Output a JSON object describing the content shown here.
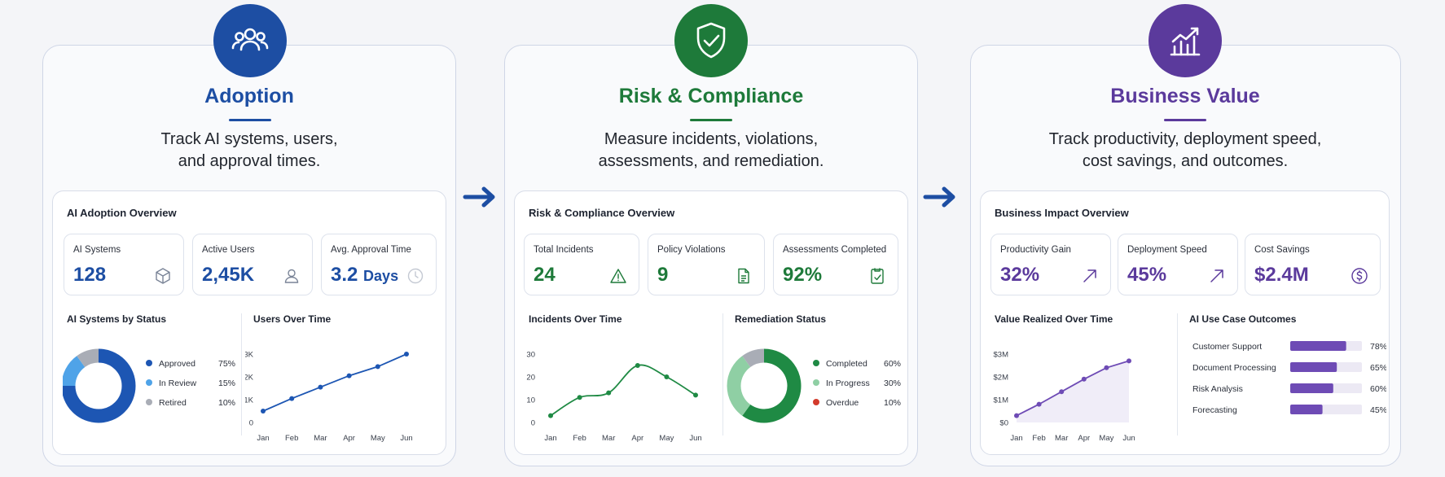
{
  "colors": {
    "adoption": "#1d4ea3",
    "risk": "#1e7a3a",
    "value": "#5b3a9c",
    "arrow": "#1d4ea3"
  },
  "adoption": {
    "title": "Adoption",
    "icon": "users-icon",
    "desc_line1": "Track AI systems, users,",
    "desc_line2": "and approval times.",
    "card_title": "AI Adoption Overview",
    "kpis": [
      {
        "label": "AI Systems",
        "value": "128",
        "icon": "cube-icon"
      },
      {
        "label": "Active Users",
        "value": "2,45K",
        "icon": "user-icon"
      },
      {
        "label": "Avg. Approval Time",
        "value": "3.2",
        "unit": "Days",
        "icon": "clock-icon"
      }
    ],
    "donut_title": "AI Systems by Status",
    "donut": [
      {
        "label": "Approved",
        "pct": "75%",
        "value": 75,
        "color": "#1d56b3"
      },
      {
        "label": "In Review",
        "pct": "15%",
        "value": 15,
        "color": "#4fa3e8"
      },
      {
        "label": "Retired",
        "pct": "10%",
        "value": 10,
        "color": "#a9adb6"
      }
    ],
    "line_title": "Users Over Time"
  },
  "risk": {
    "title": "Risk & Compliance",
    "icon": "shield-check-icon",
    "desc_line1": "Measure incidents, violations,",
    "desc_line2": "assessments, and remediation.",
    "card_title": "Risk & Compliance Overview",
    "kpis": [
      {
        "label": "Total Incidents",
        "value": "24",
        "icon": "warning-icon"
      },
      {
        "label": "Policy Violations",
        "value": "9",
        "icon": "document-icon"
      },
      {
        "label": "Assessments Completed",
        "value": "92%",
        "icon": "checklist-icon"
      }
    ],
    "line_title": "Incidents Over Time",
    "donut_title": "Remediation Status",
    "donut": [
      {
        "label": "Completed",
        "pct": "60%",
        "value": 60,
        "color": "#1f8a44"
      },
      {
        "label": "In Progress",
        "pct": "30%",
        "value": 30,
        "color": "#8fcfa4"
      },
      {
        "label": "Overdue",
        "pct": "10%",
        "value": 10,
        "color": "#a9adb6",
        "dot_color": "#d33b2c"
      }
    ]
  },
  "value": {
    "title": "Business Value",
    "icon": "growth-chart-icon",
    "desc_line1": "Track productivity, deployment speed,",
    "desc_line2": "cost savings, and outcomes.",
    "card_title": "Business Impact Overview",
    "kpis": [
      {
        "label": "Productivity Gain",
        "value": "32%",
        "icon": "trend-up-icon"
      },
      {
        "label": "Deployment Speed",
        "value": "45%",
        "icon": "trend-up-icon"
      },
      {
        "label": "Cost Savings",
        "value": "$2.4M",
        "icon": "dollar-icon"
      }
    ],
    "line_title": "Value Realized Over Time",
    "bars_title": "AI Use Case Outcomes",
    "bars": [
      {
        "label": "Customer Support",
        "pct": "78%",
        "value": 78
      },
      {
        "label": "Document Processing",
        "pct": "65%",
        "value": 65
      },
      {
        "label": "Risk Analysis",
        "pct": "60%",
        "value": 60
      },
      {
        "label": "Forecasting",
        "pct": "45%",
        "value": 45
      }
    ]
  },
  "chart_data": [
    {
      "type": "pie",
      "title": "AI Systems by Status",
      "categories": [
        "Approved",
        "In Review",
        "Retired"
      ],
      "values": [
        75,
        15,
        10
      ]
    },
    {
      "type": "line",
      "title": "Users Over Time",
      "x": [
        "Jan",
        "Feb",
        "Mar",
        "Apr",
        "May",
        "Jun"
      ],
      "y_ticks": [
        "0",
        "1K",
        "2K",
        "3K"
      ],
      "ylim": [
        0,
        3000
      ],
      "series": [
        {
          "values": [
            500,
            1050,
            1550,
            2050,
            2450,
            3000
          ]
        }
      ]
    },
    {
      "type": "line",
      "title": "Incidents Over Time",
      "x": [
        "Jan",
        "Feb",
        "Mar",
        "Apr",
        "May",
        "Jun"
      ],
      "y_ticks": [
        "0",
        "10",
        "20",
        "30"
      ],
      "ylim": [
        0,
        30
      ],
      "series": [
        {
          "values": [
            3,
            11,
            13,
            25,
            20,
            12
          ]
        }
      ]
    },
    {
      "type": "pie",
      "title": "Remediation Status",
      "categories": [
        "Completed",
        "In Progress",
        "Overdue"
      ],
      "values": [
        60,
        30,
        10
      ]
    },
    {
      "type": "line",
      "title": "Value Realized Over Time",
      "x": [
        "Jan",
        "Feb",
        "Mar",
        "Apr",
        "May",
        "Jun"
      ],
      "y_ticks": [
        "$0",
        "$1M",
        "$2M",
        "$3M"
      ],
      "ylim": [
        0,
        3
      ],
      "series": [
        {
          "values": [
            0.3,
            0.8,
            1.35,
            1.9,
            2.4,
            2.7
          ]
        }
      ]
    },
    {
      "type": "bar",
      "title": "AI Use Case Outcomes",
      "categories": [
        "Customer Support",
        "Document Processing",
        "Risk Analysis",
        "Forecasting"
      ],
      "values": [
        78,
        65,
        60,
        45
      ]
    }
  ]
}
